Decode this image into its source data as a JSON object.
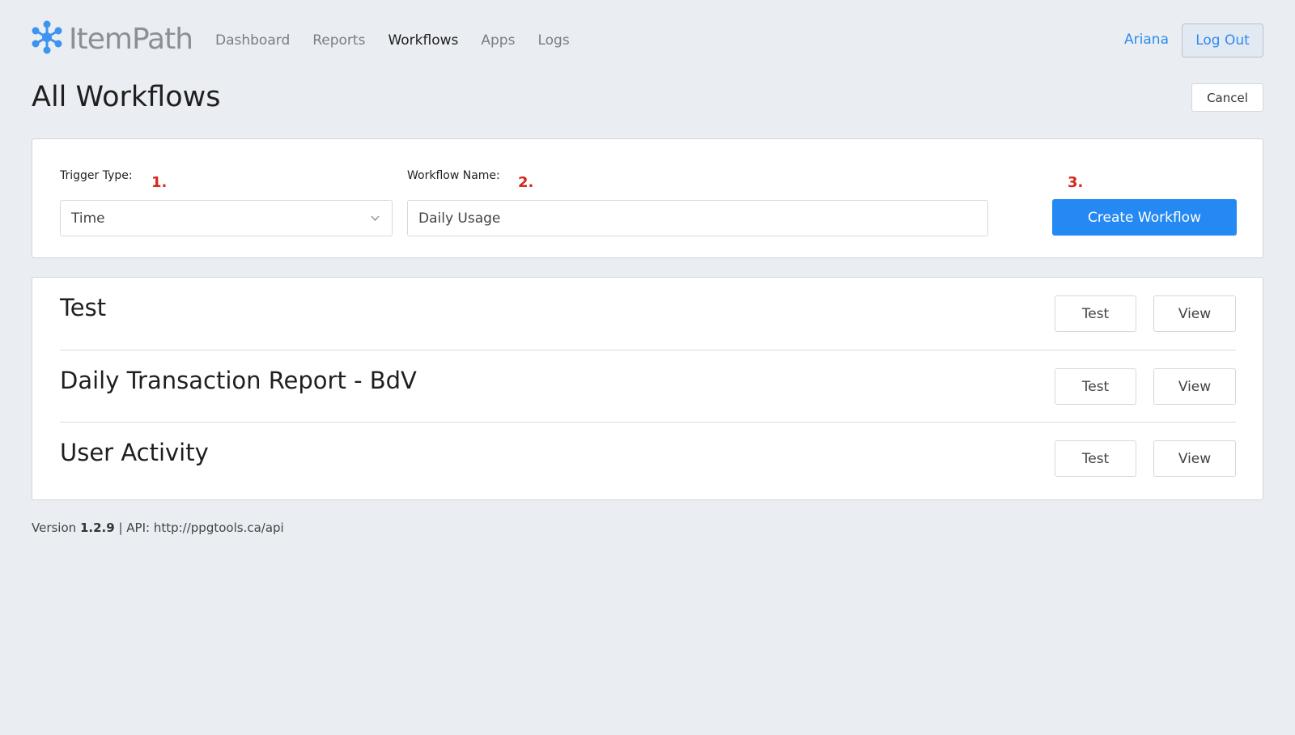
{
  "header": {
    "logo_text": "ItemPath",
    "nav": [
      {
        "label": "Dashboard",
        "active": false
      },
      {
        "label": "Reports",
        "active": false
      },
      {
        "label": "Workflows",
        "active": true
      },
      {
        "label": "Apps",
        "active": false
      },
      {
        "label": "Logs",
        "active": false
      }
    ],
    "user_name": "Ariana",
    "logout_label": "Log Out"
  },
  "page": {
    "title": "All Workflows",
    "cancel_label": "Cancel"
  },
  "create_form": {
    "trigger_label": "Trigger Type",
    "trigger_value": "Time",
    "name_label": "Workflow Name",
    "name_value": "Daily Usage",
    "create_label": "Create Workflow",
    "markers": [
      "1.",
      "2.",
      "3."
    ]
  },
  "workflows": [
    {
      "name": "Test",
      "test_label": "Test",
      "view_label": "View"
    },
    {
      "name": "Daily Transaction Report - BdV",
      "test_label": "Test",
      "view_label": "View"
    },
    {
      "name": "User Activity",
      "test_label": "Test",
      "view_label": "View"
    }
  ],
  "footer": {
    "version_prefix": "Version",
    "version": "1.2.9",
    "api_text": "| API: http://ppgtools.ca/api"
  },
  "colors": {
    "accent": "#2489f2",
    "background": "#eaedf2",
    "marker": "#d42a1f",
    "logo_icon": "#3d94ee"
  }
}
